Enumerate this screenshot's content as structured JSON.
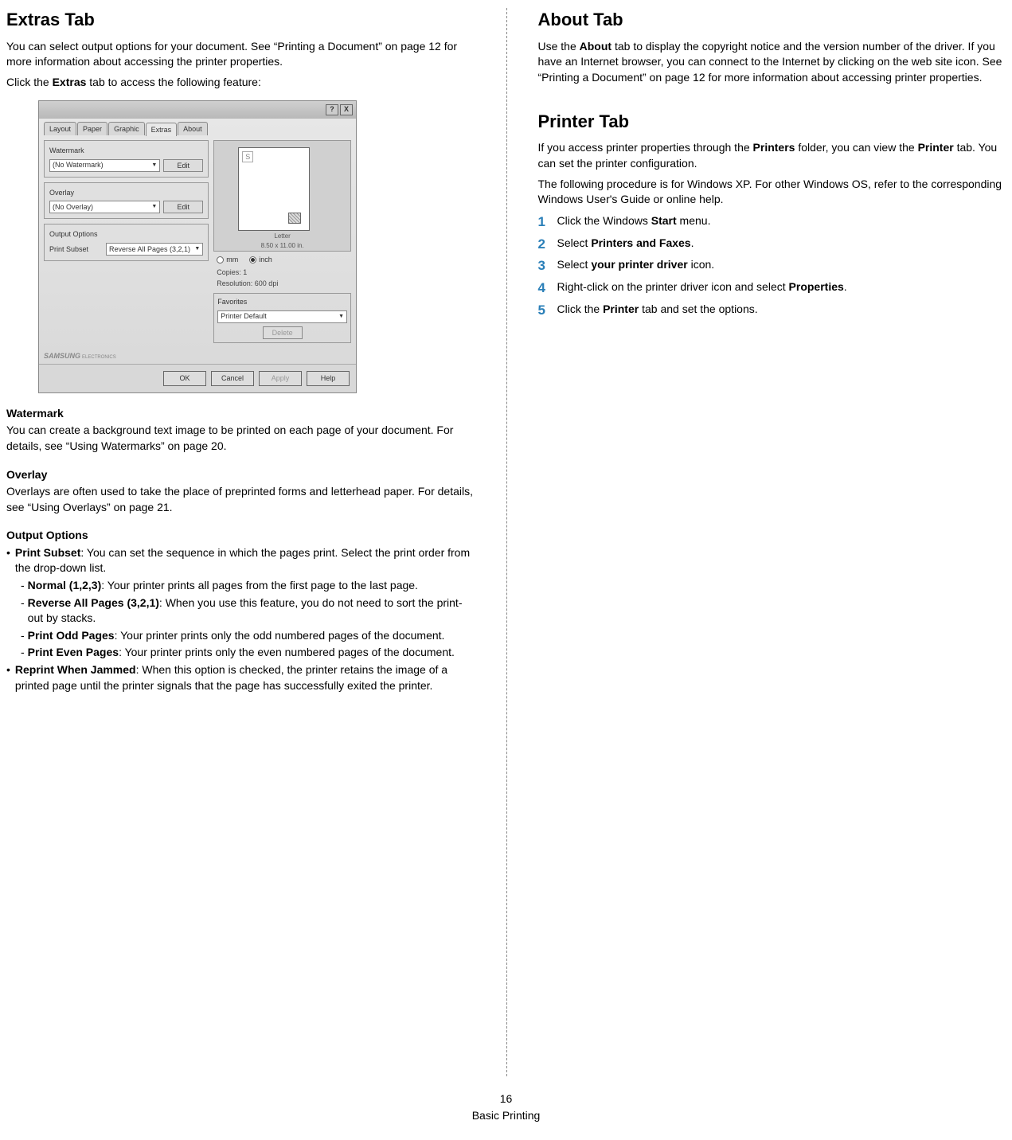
{
  "left": {
    "heading": "Extras Tab",
    "intro": "You can select output options for your document. See “Printing a Document” on page 12 for more information about accessing the printer properties.",
    "intro2_pre": "Click the ",
    "intro2_bold": "Extras",
    "intro2_post": " tab to access the following feature:",
    "watermark_h": "Watermark",
    "watermark_p": "You can create a background text image to be printed on each page of your document. For details, see “Using Watermarks” on page 20.",
    "overlay_h": "Overlay",
    "overlay_p": "Overlays are often used to take the place of preprinted forms and letterhead paper. For details, see “Using Overlays” on page 21.",
    "output_h": "Output Options",
    "ps_bold": "Print Subset",
    "ps_text": ": You can set the sequence in which the pages print. Select the print order from the drop-down list.",
    "normal_bold": "Normal (1,2,3)",
    "normal_text": ": Your printer prints all pages from the first page to the last page.",
    "reverse_bold": "Reverse All Pages (3,2,1)",
    "reverse_text": ": When you use this feature, you do not need to sort the print-out by stacks.",
    "odd_bold": "Print Odd Pages",
    "odd_text": ": Your printer prints only the odd numbered pages of the document.",
    "even_bold": "Print Even Pages",
    "even_text": ": Your printer prints only the even numbered pages of the document.",
    "reprint_bold": "Reprint When Jammed",
    "reprint_text": ": When this option is checked, the printer retains the image of a printed page until the printer signals that the page has successfully exited the printer."
  },
  "dialog": {
    "help_btn": "?",
    "close_btn": "X",
    "tabs": {
      "t1": "Layout",
      "t2": "Paper",
      "t3": "Graphic",
      "t4": "Extras",
      "t5": "About"
    },
    "watermark_label": "Watermark",
    "watermark_value": "(No Watermark)",
    "edit_btn": "Edit",
    "overlay_label": "Overlay",
    "overlay_value": "(No Overlay)",
    "output_label": "Output Options",
    "print_subset_label": "Print Subset",
    "print_subset_value": "Reverse All Pages (3,2,1)",
    "paper_size1": "Letter",
    "paper_size2": "8.50 x 11.00 in.",
    "unit_mm": "mm",
    "unit_inch": "inch",
    "copies": "Copies: 1",
    "resolution": "Resolution: 600 dpi",
    "favorites": "Favorites",
    "favorites_value": "Printer Default",
    "delete_btn": "Delete",
    "logo": "SAMSUNG",
    "logo_sub": "ELECTRONICS",
    "ok": "OK",
    "cancel": "Cancel",
    "apply": "Apply",
    "help": "Help",
    "s_mark": "S"
  },
  "right": {
    "about_h": "About Tab",
    "about_p_pre": "Use the ",
    "about_p_bold": "About",
    "about_p_post": " tab to display the copyright notice and the version number of the driver. If you have an Internet browser, you can connect to the Internet by clicking on the web site icon. See “Printing a Document” on page 12 for more information about accessing printer properties.",
    "printer_h": "Printer Tab",
    "printer_p1_pre": "If you access printer properties through the ",
    "printer_p1_bold1": "Printers",
    "printer_p1_mid": " folder, you can view the ",
    "printer_p1_bold2": "Printer",
    "printer_p1_post": " tab. You can set the printer configuration.",
    "printer_p2": "The following procedure is for Windows XP. For other Windows OS, refer to the corresponding Windows User's Guide or online help.",
    "steps": {
      "n1": "1",
      "s1_pre": "Click the Windows ",
      "s1_bold": "Start",
      "s1_post": " menu.",
      "n2": "2",
      "s2_pre": "Select ",
      "s2_bold": "Printers and Faxes",
      "s2_post": ".",
      "n3": "3",
      "s3_pre": "Select ",
      "s3_bold": "your printer driver",
      "s3_post": " icon.",
      "n4": "4",
      "s4_pre": "Right-click on the printer driver icon and select ",
      "s4_bold": "Properties",
      "s4_post": ".",
      "n5": "5",
      "s5_pre": "Click the ",
      "s5_bold": "Printer",
      "s5_post": " tab and set the options."
    }
  },
  "footer": {
    "page": "16",
    "label": "Basic Printing"
  }
}
